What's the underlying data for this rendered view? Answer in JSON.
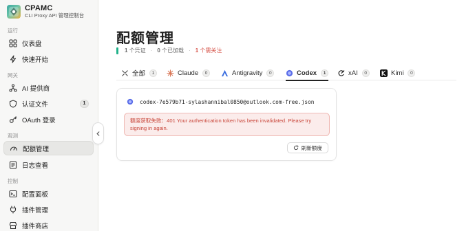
{
  "brand": {
    "title": "CPAMC",
    "subtitle": "CLI Proxy API 管理控制台"
  },
  "sidebar": {
    "sections": [
      {
        "label": "运行"
      },
      {
        "label": "网关"
      },
      {
        "label": "观测"
      },
      {
        "label": "控制"
      }
    ],
    "items": [
      {
        "label": "仪表盘",
        "icon": "dashboard-grid-icon"
      },
      {
        "label": "快速开始",
        "icon": "lightning-icon"
      },
      {
        "label": "AI 提供商",
        "icon": "network-nodes-icon"
      },
      {
        "label": "认证文件",
        "icon": "shield-icon",
        "badge": "1"
      },
      {
        "label": "OAuth 登录",
        "icon": "key-icon"
      },
      {
        "label": "配额管理",
        "icon": "gauge-icon",
        "active": true
      },
      {
        "label": "日志查看",
        "icon": "document-lines-icon"
      },
      {
        "label": "配置面板",
        "icon": "terminal-icon"
      },
      {
        "label": "插件管理",
        "icon": "plug-icon"
      },
      {
        "label": "插件商店",
        "icon": "store-icon"
      }
    ]
  },
  "main": {
    "title": "配额管理",
    "stats": {
      "credentials_count": "1",
      "credentials_label": "个凭证",
      "loaded_count": "0",
      "loaded_label": "个已加载",
      "attention_count": "1",
      "attention_label": "个需关注"
    },
    "tabs": [
      {
        "label": "全部",
        "count": "1",
        "icon": "all-icon"
      },
      {
        "label": "Claude",
        "count": "0",
        "icon": "claude-icon"
      },
      {
        "label": "Antigravity",
        "count": "0",
        "icon": "antigravity-icon"
      },
      {
        "label": "Codex",
        "count": "1",
        "icon": "codex-icon",
        "active": true
      },
      {
        "label": "xAI",
        "count": "0",
        "icon": "xai-icon"
      },
      {
        "label": "Kimi",
        "count": "0",
        "icon": "kimi-icon"
      }
    ],
    "card": {
      "filename": "codex-7e579b71-sylashannibal0850@outlook.com-free.json",
      "error": "额度获取失败：401 Your authentication token has been invalidated. Please try signing in again.",
      "refresh_label": "刷新额度"
    }
  },
  "colors": {
    "accent_green": "#21b28a",
    "attention_red": "#d6544a",
    "error_bg": "#fbeceb",
    "error_border": "#efb9b4"
  }
}
